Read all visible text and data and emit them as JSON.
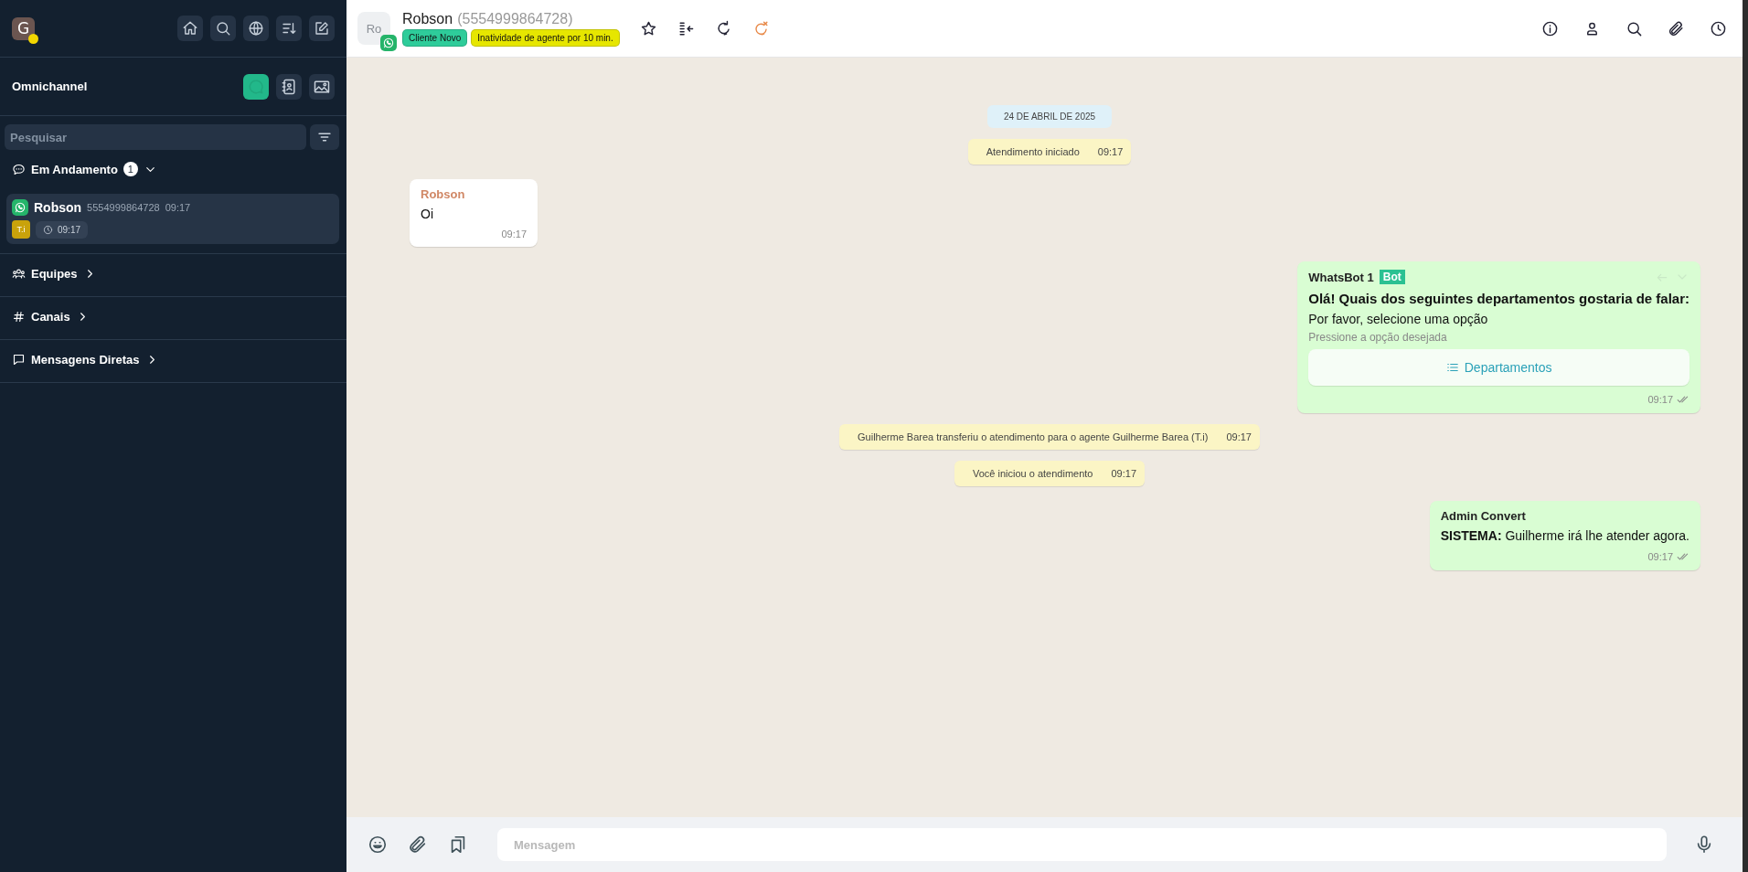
{
  "sidebar": {
    "user_avatar": {
      "initial": "G",
      "away": true
    },
    "section_title": "Omnichannel",
    "views": [
      {
        "kind": "chats",
        "selected": true
      },
      {
        "kind": "contacts",
        "selected": false
      },
      {
        "kind": "media",
        "selected": false
      }
    ],
    "search": {
      "placeholder": "Pesquisar"
    },
    "groups": [
      {
        "kind": "chats",
        "label": "Em Andamento",
        "count": "1",
        "expanded": true,
        "conversations": [
          {
            "name": "Robson",
            "phone": "5554999864728",
            "time": "09:17",
            "agent": "T.i",
            "waiting": "09:17",
            "selected": true
          }
        ]
      },
      {
        "kind": "teams",
        "label": "Equipes",
        "expanded": false
      },
      {
        "kind": "channels",
        "label": "Canais",
        "expanded": false
      },
      {
        "kind": "direct",
        "label": "Mensagens Diretas",
        "expanded": false
      }
    ]
  },
  "chat_header": {
    "avatar": "Ro",
    "name": "Robson",
    "phone": "(5554999864728)",
    "tags": [
      {
        "label": "Cliente Novo",
        "color": "#2ecc9a"
      },
      {
        "label": "Inatividade de agente por 10 min.",
        "color": "#e6e600"
      }
    ]
  },
  "messages": [
    {
      "kind": "date",
      "text": "24 DE ABRIL DE 2025"
    },
    {
      "kind": "event",
      "text": "Atendimento iniciado",
      "time": "09:17"
    },
    {
      "kind": "incoming",
      "sender": "Robson",
      "text": "Oi",
      "time": "09:17"
    },
    {
      "kind": "outgoing",
      "sender": "WhatsBot 1",
      "badge": "Bot",
      "title": "Olá! Quais dos seguintes departamentos gostaria de falar:",
      "text": "Por favor, selecione uma opção",
      "footer": "Pressione a opção desejada",
      "button": "Departamentos",
      "time": "09:17"
    },
    {
      "kind": "event",
      "text": "Guilherme Barea transferiu o atendimento para o agente Guilherme Barea (T.i)",
      "time": "09:17"
    },
    {
      "kind": "event",
      "text": "Você iniciou o atendimento",
      "time": "09:17"
    },
    {
      "kind": "outgoing",
      "sender": "Admin Convert",
      "text": "**SISTEMA:** Guilherme irá lhe atender agora.",
      "time": "09:17"
    }
  ],
  "composer": {
    "placeholder": "Mensagem"
  }
}
